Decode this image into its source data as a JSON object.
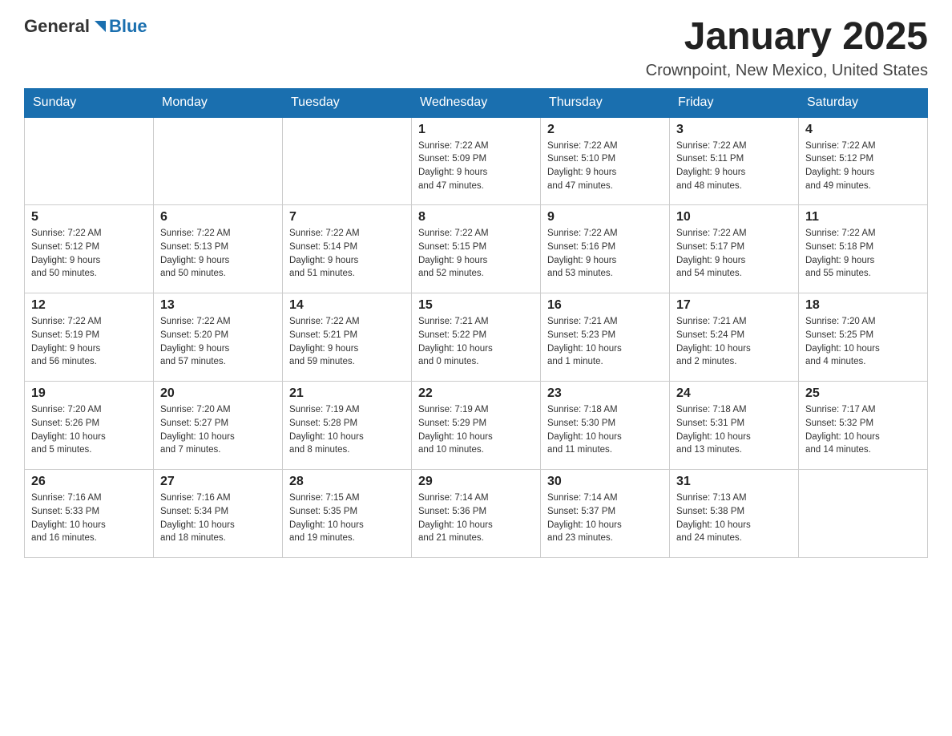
{
  "logo": {
    "general": "General",
    "blue": "Blue"
  },
  "title": "January 2025",
  "location": "Crownpoint, New Mexico, United States",
  "days_of_week": [
    "Sunday",
    "Monday",
    "Tuesday",
    "Wednesday",
    "Thursday",
    "Friday",
    "Saturday"
  ],
  "weeks": [
    [
      {
        "day": "",
        "info": ""
      },
      {
        "day": "",
        "info": ""
      },
      {
        "day": "",
        "info": ""
      },
      {
        "day": "1",
        "info": "Sunrise: 7:22 AM\nSunset: 5:09 PM\nDaylight: 9 hours\nand 47 minutes."
      },
      {
        "day": "2",
        "info": "Sunrise: 7:22 AM\nSunset: 5:10 PM\nDaylight: 9 hours\nand 47 minutes."
      },
      {
        "day": "3",
        "info": "Sunrise: 7:22 AM\nSunset: 5:11 PM\nDaylight: 9 hours\nand 48 minutes."
      },
      {
        "day": "4",
        "info": "Sunrise: 7:22 AM\nSunset: 5:12 PM\nDaylight: 9 hours\nand 49 minutes."
      }
    ],
    [
      {
        "day": "5",
        "info": "Sunrise: 7:22 AM\nSunset: 5:12 PM\nDaylight: 9 hours\nand 50 minutes."
      },
      {
        "day": "6",
        "info": "Sunrise: 7:22 AM\nSunset: 5:13 PM\nDaylight: 9 hours\nand 50 minutes."
      },
      {
        "day": "7",
        "info": "Sunrise: 7:22 AM\nSunset: 5:14 PM\nDaylight: 9 hours\nand 51 minutes."
      },
      {
        "day": "8",
        "info": "Sunrise: 7:22 AM\nSunset: 5:15 PM\nDaylight: 9 hours\nand 52 minutes."
      },
      {
        "day": "9",
        "info": "Sunrise: 7:22 AM\nSunset: 5:16 PM\nDaylight: 9 hours\nand 53 minutes."
      },
      {
        "day": "10",
        "info": "Sunrise: 7:22 AM\nSunset: 5:17 PM\nDaylight: 9 hours\nand 54 minutes."
      },
      {
        "day": "11",
        "info": "Sunrise: 7:22 AM\nSunset: 5:18 PM\nDaylight: 9 hours\nand 55 minutes."
      }
    ],
    [
      {
        "day": "12",
        "info": "Sunrise: 7:22 AM\nSunset: 5:19 PM\nDaylight: 9 hours\nand 56 minutes."
      },
      {
        "day": "13",
        "info": "Sunrise: 7:22 AM\nSunset: 5:20 PM\nDaylight: 9 hours\nand 57 minutes."
      },
      {
        "day": "14",
        "info": "Sunrise: 7:22 AM\nSunset: 5:21 PM\nDaylight: 9 hours\nand 59 minutes."
      },
      {
        "day": "15",
        "info": "Sunrise: 7:21 AM\nSunset: 5:22 PM\nDaylight: 10 hours\nand 0 minutes."
      },
      {
        "day": "16",
        "info": "Sunrise: 7:21 AM\nSunset: 5:23 PM\nDaylight: 10 hours\nand 1 minute."
      },
      {
        "day": "17",
        "info": "Sunrise: 7:21 AM\nSunset: 5:24 PM\nDaylight: 10 hours\nand 2 minutes."
      },
      {
        "day": "18",
        "info": "Sunrise: 7:20 AM\nSunset: 5:25 PM\nDaylight: 10 hours\nand 4 minutes."
      }
    ],
    [
      {
        "day": "19",
        "info": "Sunrise: 7:20 AM\nSunset: 5:26 PM\nDaylight: 10 hours\nand 5 minutes."
      },
      {
        "day": "20",
        "info": "Sunrise: 7:20 AM\nSunset: 5:27 PM\nDaylight: 10 hours\nand 7 minutes."
      },
      {
        "day": "21",
        "info": "Sunrise: 7:19 AM\nSunset: 5:28 PM\nDaylight: 10 hours\nand 8 minutes."
      },
      {
        "day": "22",
        "info": "Sunrise: 7:19 AM\nSunset: 5:29 PM\nDaylight: 10 hours\nand 10 minutes."
      },
      {
        "day": "23",
        "info": "Sunrise: 7:18 AM\nSunset: 5:30 PM\nDaylight: 10 hours\nand 11 minutes."
      },
      {
        "day": "24",
        "info": "Sunrise: 7:18 AM\nSunset: 5:31 PM\nDaylight: 10 hours\nand 13 minutes."
      },
      {
        "day": "25",
        "info": "Sunrise: 7:17 AM\nSunset: 5:32 PM\nDaylight: 10 hours\nand 14 minutes."
      }
    ],
    [
      {
        "day": "26",
        "info": "Sunrise: 7:16 AM\nSunset: 5:33 PM\nDaylight: 10 hours\nand 16 minutes."
      },
      {
        "day": "27",
        "info": "Sunrise: 7:16 AM\nSunset: 5:34 PM\nDaylight: 10 hours\nand 18 minutes."
      },
      {
        "day": "28",
        "info": "Sunrise: 7:15 AM\nSunset: 5:35 PM\nDaylight: 10 hours\nand 19 minutes."
      },
      {
        "day": "29",
        "info": "Sunrise: 7:14 AM\nSunset: 5:36 PM\nDaylight: 10 hours\nand 21 minutes."
      },
      {
        "day": "30",
        "info": "Sunrise: 7:14 AM\nSunset: 5:37 PM\nDaylight: 10 hours\nand 23 minutes."
      },
      {
        "day": "31",
        "info": "Sunrise: 7:13 AM\nSunset: 5:38 PM\nDaylight: 10 hours\nand 24 minutes."
      },
      {
        "day": "",
        "info": ""
      }
    ]
  ]
}
